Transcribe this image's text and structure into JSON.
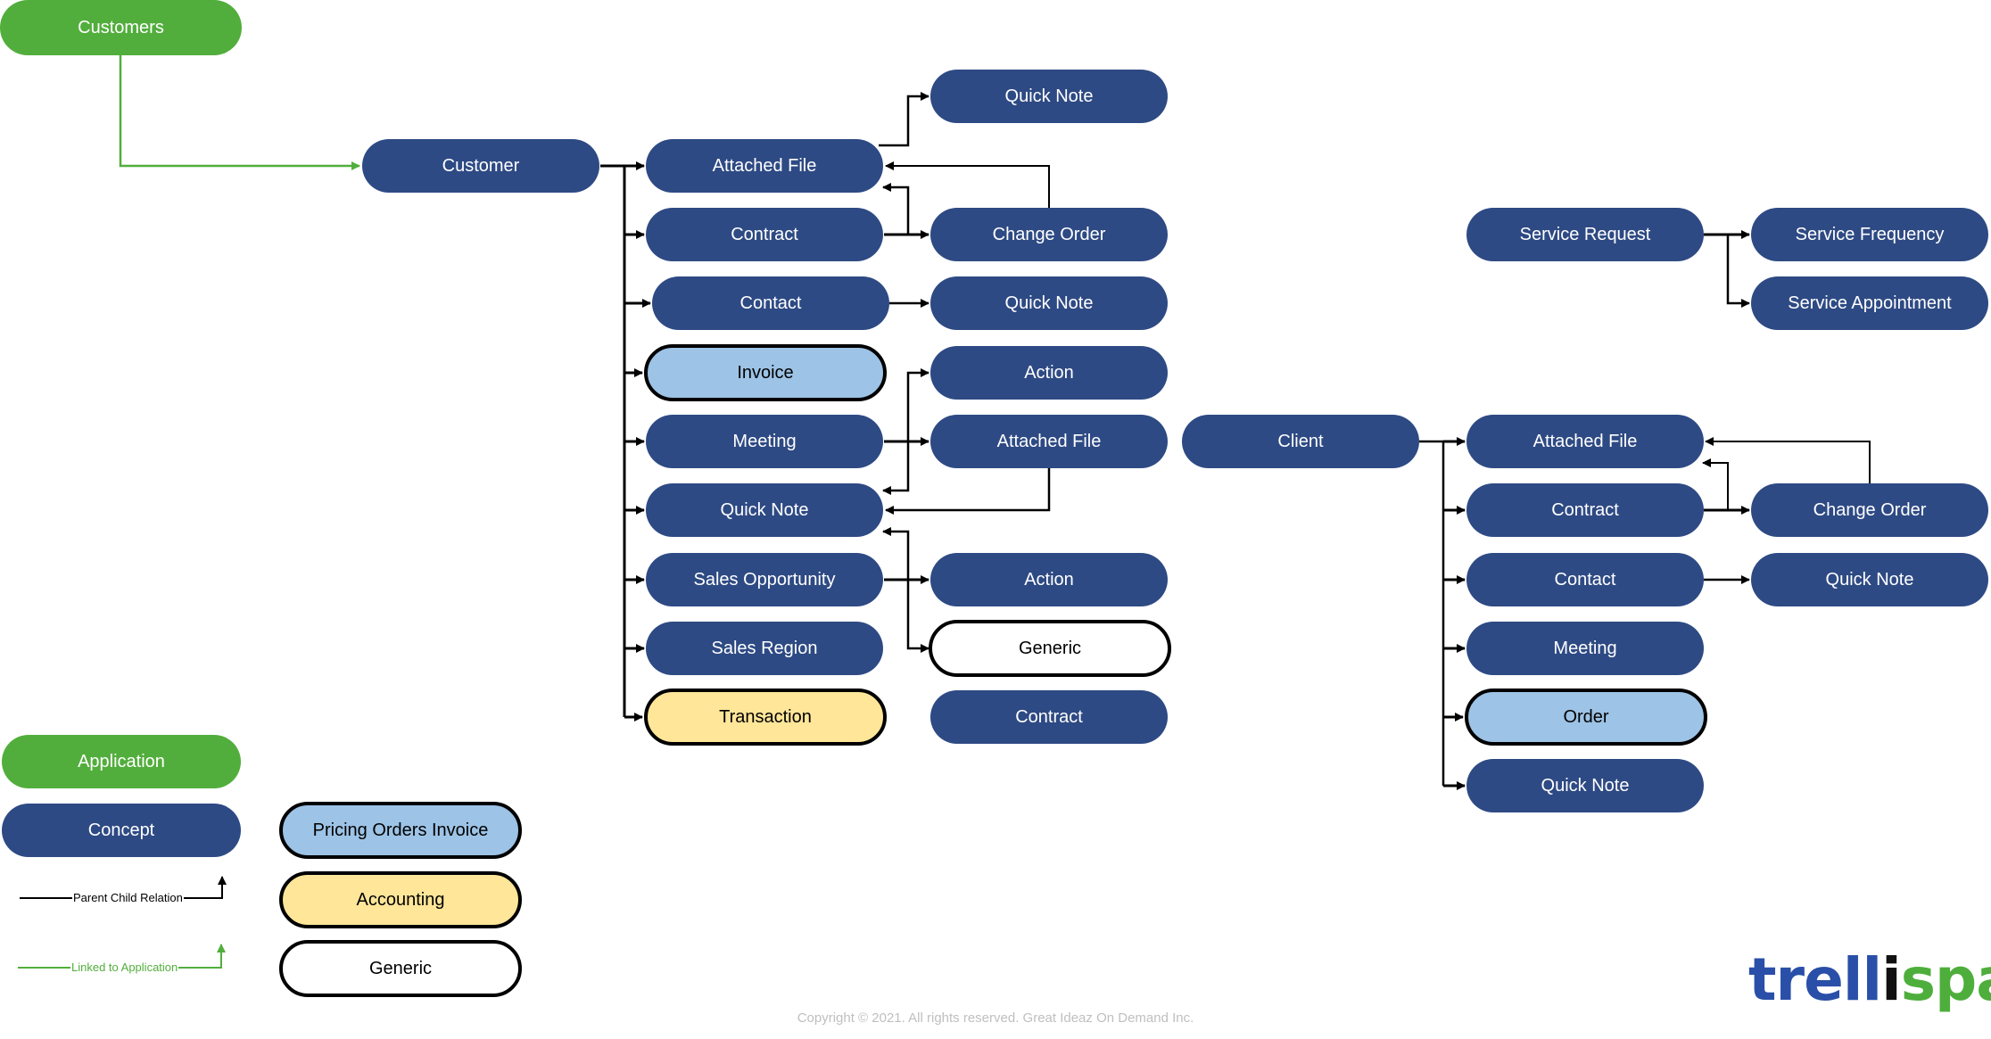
{
  "colors": {
    "application": "#52AE3C",
    "concept": "#2E4A84",
    "pricing_orders_invoice": "#9DC3E6",
    "accounting": "#FFE699",
    "generic": "#FFFFFF",
    "parent_child_line": "#000000",
    "linked_line": "#52AE3C"
  },
  "application": {
    "label": "Customers"
  },
  "customer_tree": {
    "root": "Customer",
    "children": [
      {
        "label": "Attached File",
        "type": "concept"
      },
      {
        "label": "Contract",
        "type": "concept"
      },
      {
        "label": "Contact",
        "type": "concept"
      },
      {
        "label": "Invoice",
        "type": "pricing"
      },
      {
        "label": "Meeting",
        "type": "concept"
      },
      {
        "label": "Quick Note",
        "type": "concept"
      },
      {
        "label": "Sales Opportunity",
        "type": "concept"
      },
      {
        "label": "Sales Region",
        "type": "concept"
      },
      {
        "label": "Transaction",
        "type": "accounting"
      }
    ],
    "second_level": [
      {
        "label": "Quick Note",
        "type": "concept"
      },
      {
        "label": "Change Order",
        "type": "concept"
      },
      {
        "label": "Quick Note",
        "type": "concept"
      },
      {
        "label": "Action",
        "type": "concept"
      },
      {
        "label": "Attached File",
        "type": "concept"
      },
      {
        "label": "Action",
        "type": "concept"
      },
      {
        "label": "Generic",
        "type": "generic"
      },
      {
        "label": "Contract",
        "type": "concept"
      }
    ]
  },
  "client_tree": {
    "root": "Client",
    "children": [
      {
        "label": "Attached File",
        "type": "concept"
      },
      {
        "label": "Contract",
        "type": "concept"
      },
      {
        "label": "Contact",
        "type": "concept"
      },
      {
        "label": "Meeting",
        "type": "concept"
      },
      {
        "label": "Order",
        "type": "pricing"
      },
      {
        "label": "Quick Note",
        "type": "concept"
      }
    ],
    "second_level": [
      {
        "label": "Change Order",
        "type": "concept"
      },
      {
        "label": "Quick Note",
        "type": "concept"
      }
    ]
  },
  "service_tree": {
    "root": "Service Request",
    "children": [
      {
        "label": "Service Frequency",
        "type": "concept"
      },
      {
        "label": "Service Appointment",
        "type": "concept"
      }
    ]
  },
  "legend": {
    "application": "Application",
    "concept": "Concept",
    "pricing": "Pricing Orders Invoice",
    "accounting": "Accounting",
    "generic": "Generic",
    "parent_child": "Parent Child Relation",
    "linked": "Linked to Application"
  },
  "footer": {
    "copyright": "Copyright © 2021. All rights reserved. Great Ideaz On Demand Inc."
  },
  "logo": {
    "part1": "trell",
    "part2": "i",
    "part3": "spark"
  }
}
